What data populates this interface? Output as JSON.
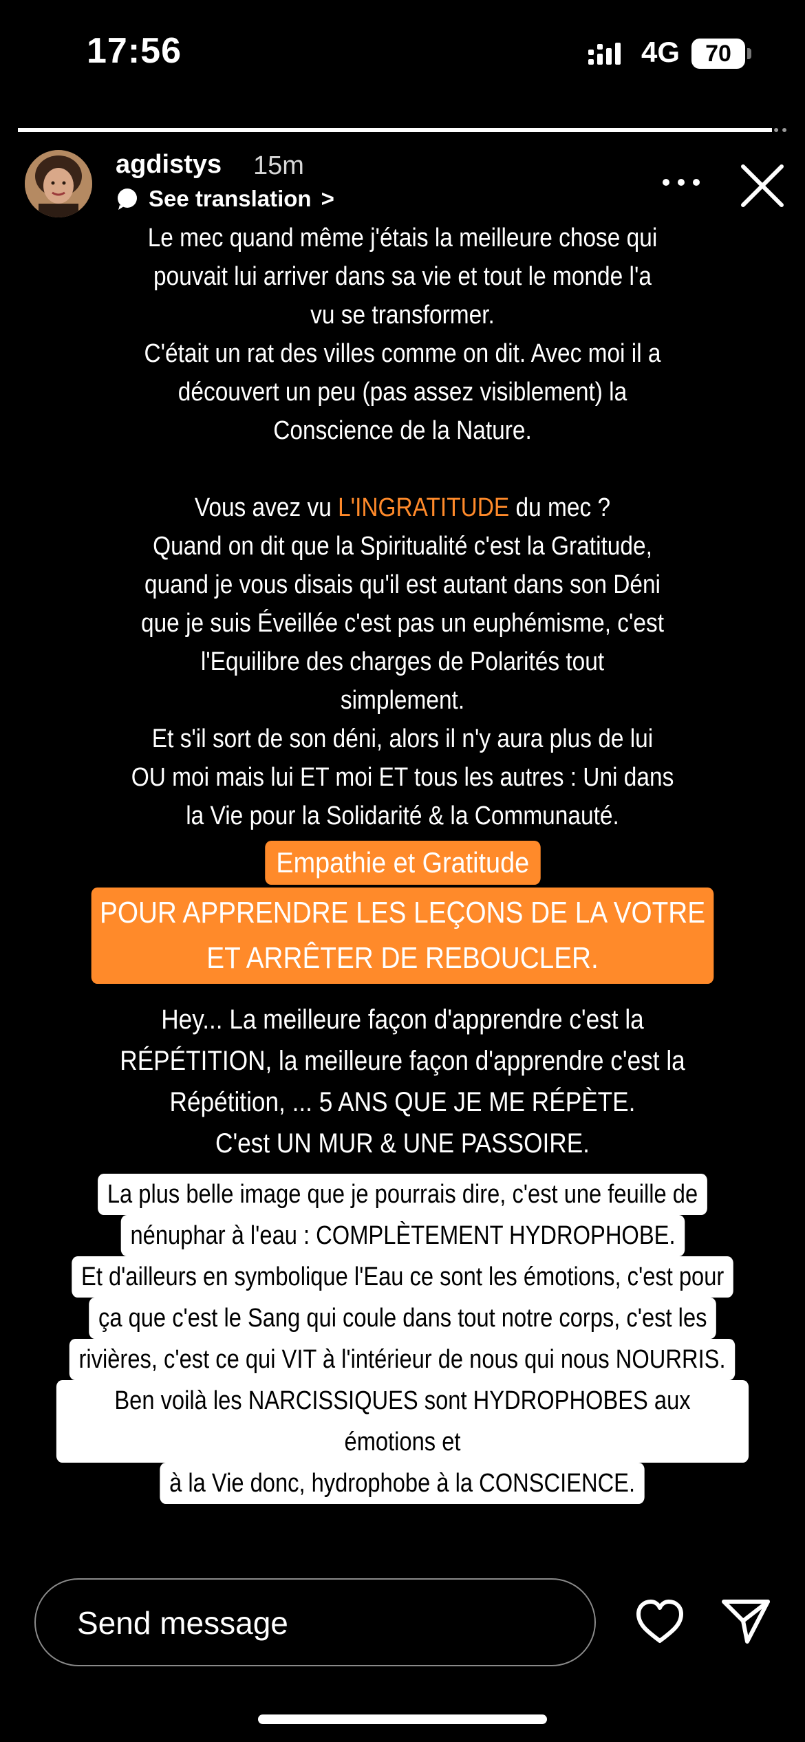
{
  "status_bar": {
    "time": "17:56",
    "network": "4G",
    "battery_level": "70"
  },
  "story": {
    "progress_fraction": 0.98,
    "username": "agdistys",
    "posted": "15m",
    "translate_label": "See translation",
    "chevron": ">",
    "block1": {
      "line1": "Le mec quand même j'étais la meilleure chose qui",
      "line2": "pouvait lui arriver dans sa vie et tout le monde l'a",
      "line3": "vu se transformer.",
      "line4": "C'était un rat des villes comme on dit. Avec moi il a",
      "line5": "découvert un peu (pas assez visiblement) la",
      "line6": "Conscience de la Nature.",
      "line7_pre": "Vous avez vu ",
      "line7_highlight": "L'INGRATITUDE",
      "line7_post": " du mec ?",
      "line8": "Quand on dit que la Spiritualité c'est la Gratitude,",
      "line9": "quand je vous disais qu'il est autant dans son Déni",
      "line10": "que je suis Éveillée c'est pas un euphémisme, c'est",
      "line11": "l'Equilibre des charges de Polarités tout",
      "line12": "simplement.",
      "line13": "Et s'il sort de son déni, alors il n'y aura plus de lui",
      "line14": "OU moi mais lui ET moi ET tous les autres : Uni dans",
      "line15": "la Vie pour la Solidarité & la Communauté."
    },
    "highlight1": "Empathie et Gratitude",
    "highlight2_line1": "POUR APPRENDRE LES LEÇONS DE LA VOTRE",
    "highlight2_line2": "ET ARRÊTER DE REBOUCLER.",
    "block2": {
      "line1": "Hey... La meilleure façon d'apprendre c'est la",
      "line2": "RÉPÉTITION, la meilleure façon d'apprendre c'est la",
      "line3": "Répétition, ... 5 ANS QUE JE ME RÉPÈTE.",
      "line4": "C'est UN MUR & UNE PASSOIRE."
    },
    "block3": {
      "line1": "La plus belle image que je pourrais dire, c'est une feuille de",
      "line2": "nénuphar à l'eau : COMPLÈTEMENT HYDROPHOBE.",
      "line3": "Et d'ailleurs en symbolique l'Eau ce sont les émotions, c'est pour",
      "line4": "ça que c'est le Sang qui coule dans tout notre corps, c'est les",
      "line5": "rivières, c'est ce qui VIT à l'intérieur de nous qui nous NOURRIS.",
      "line6": "Ben voilà les NARCISSIQUES sont HYDROPHOBES aux émotions et",
      "line7": "à la Vie donc, hydrophobe à la CONSCIENCE."
    }
  },
  "footer": {
    "message_placeholder": "Send message"
  },
  "colors": {
    "accent_orange": "#ff8a2a",
    "background": "#000000"
  },
  "icons": [
    "signal-icon",
    "battery-icon",
    "translate-icon",
    "more-icon",
    "close-icon",
    "heart-icon",
    "send-icon"
  ]
}
